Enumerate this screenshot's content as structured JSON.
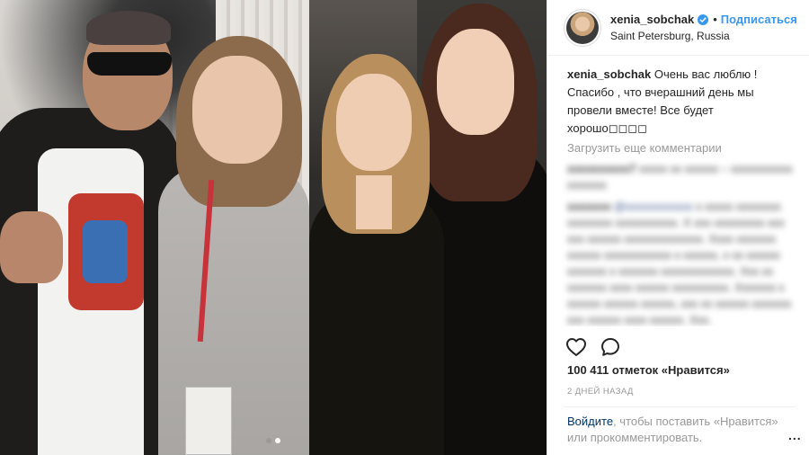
{
  "header": {
    "username": "xenia_sobchak",
    "follow_label": "Подписаться",
    "location": "Saint Petersburg, Russia",
    "verified_icon": "verified-badge-icon",
    "verified_color": "#3897f0"
  },
  "caption": {
    "username": "xenia_sobchak",
    "text": "Очень вас люблю ! Спасибо , что вчерашний день мы провели вместе! Все будет хорошо◻◻◻◻"
  },
  "comments": {
    "load_more_label": "Загрузить еще комментарии"
  },
  "actions": {
    "like_icon": "heart-icon",
    "comment_icon": "comment-icon"
  },
  "likes_text": "100 411 отметок «Нравится»",
  "timestamp": "2 ДНЕЙ НАЗАД",
  "login_prompt": {
    "link_text": "Войдите",
    "rest_text": ", чтобы поставить «Нравится» или прокомментировать."
  },
  "more_label": "...",
  "carousel": {
    "count": 2,
    "active_index": 2
  },
  "colors": {
    "link_blue": "#3897f0",
    "muted_gray": "#999999",
    "text": "#262626",
    "border": "#efefef"
  }
}
